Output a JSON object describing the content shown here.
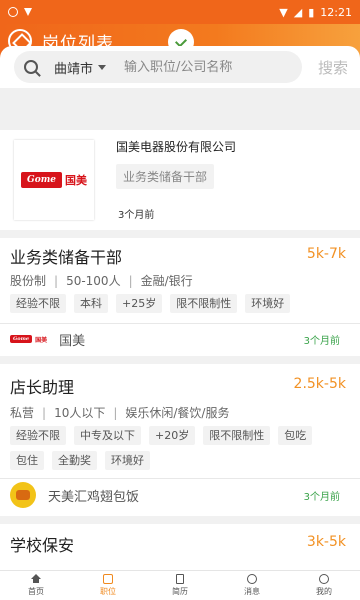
{
  "status_bar": {
    "time": "12:21"
  },
  "header": {
    "title": "岗位列表"
  },
  "search": {
    "city": "曲靖市",
    "placeholder": "输入职位/公司名称",
    "button_label": "搜索"
  },
  "company_card": {
    "name": "国美电器股份有限公司",
    "tag": "业务类储备干部",
    "posted": "3个月前",
    "logo_text_en": "Gome",
    "logo_text_cn": "国美"
  },
  "jobs": [
    {
      "title": "业务类储备干部",
      "salary": "5k-7k",
      "meta": [
        "股份制",
        "50-100人",
        "金融/银行"
      ],
      "tags": [
        "经验不限",
        "本科",
        "+25岁",
        "限不限制性",
        "环境好"
      ],
      "company": "国美",
      "posted": "3个月前"
    },
    {
      "title": "店长助理",
      "salary": "2.5k-5k",
      "meta": [
        "私营",
        "10人以下",
        "娱乐休闲/餐饮/服务"
      ],
      "tags": [
        "经验不限",
        "中专及以下",
        "+20岁",
        "限不限制性",
        "包吃",
        "包住",
        "全勤奖",
        "环境好"
      ],
      "company": "天美汇鸡翅包饭",
      "posted": "3个月前"
    },
    {
      "title": "学校保安",
      "salary": "3k-5k"
    }
  ],
  "bottom_nav": [
    {
      "label": "首页",
      "icon": "home-icon"
    },
    {
      "label": "职位",
      "icon": "job-icon",
      "active": true
    },
    {
      "label": "简历",
      "icon": "resume-icon"
    },
    {
      "label": "消息",
      "icon": "message-icon"
    },
    {
      "label": "我的",
      "icon": "profile-icon"
    }
  ],
  "colors": {
    "primary": "#f0661a",
    "salary": "#f29225",
    "posted": "#3aa34a",
    "logo_red": "#d7141b"
  }
}
